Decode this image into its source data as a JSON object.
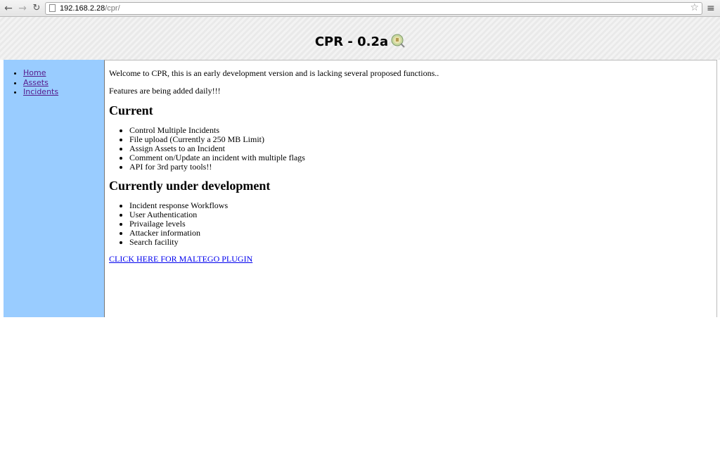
{
  "browser": {
    "url_host": "192.168.2.28",
    "url_path": "/cpr/"
  },
  "header": {
    "title": "CPR - 0.2a"
  },
  "sidebar": {
    "items": [
      {
        "label": "Home"
      },
      {
        "label": "Assets"
      },
      {
        "label": "Incidents"
      }
    ]
  },
  "main": {
    "intro": "Welcome to CPR, this is an early development version and is lacking several proposed functions..",
    "features_note": "Features are being added daily!!!",
    "current_heading": "Current",
    "current_items": [
      "Control Multiple Incidents",
      "File upload (Currently a 250 MB Limit)",
      "Assign Assets to an Incident",
      "Comment on/Update an incident with multiple flags",
      "API for 3rd party tools!!"
    ],
    "dev_heading": "Currently under development",
    "dev_items": [
      "Incident response Workflows",
      "User Authentication",
      "Privailage levels",
      "Attacker information",
      "Search facility"
    ],
    "plugin_link": "CLICK HERE FOR MALTEGO PLUGIN"
  },
  "colors": {
    "sidebar_bg": "#99ccff",
    "link": "#0000ee"
  }
}
